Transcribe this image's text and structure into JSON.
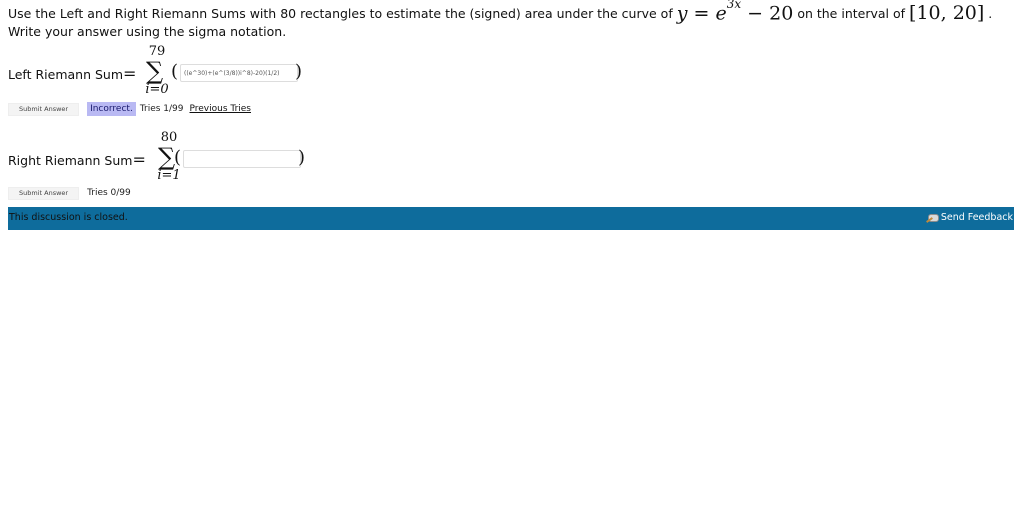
{
  "problem": {
    "intro": "Use the Left and Right Riemann Sums with 80 rectangles to estimate the (signed) area under the curve of",
    "func_y": "y",
    "func_eq": "=",
    "func_base": "e",
    "func_exp": "3x",
    "func_rest": "− 20",
    "interval_text": "on the interval of",
    "interval": "[10, 20]",
    "period": ".",
    "instruction": "Write your answer using the sigma notation."
  },
  "left_sum": {
    "label": "Left Riemann Sum",
    "equals": "=",
    "upper": "79",
    "lower": "i=0",
    "sigma": "∑",
    "open_paren": "(",
    "close_paren": ")",
    "input_value": "((e^30)+(e^(3/8))i^8)-20)(1/2)",
    "submit_label": "Submit Answer",
    "status": "Incorrect.",
    "tries": "Tries 1/99",
    "previous_tries": "Previous Tries"
  },
  "right_sum": {
    "label": "Right Riemann Sum",
    "equals": "=",
    "upper": "80",
    "lower": "i=1",
    "sigma": "∑",
    "open_paren": "(",
    "close_paren": ")",
    "input_value": "",
    "submit_label": "Submit Answer",
    "tries": "Tries 0/99"
  },
  "discussion": {
    "closed_text": "This discussion is closed.",
    "feedback_label": "Send Feedback",
    "feedback_icon": "feedback-pencil-icon",
    "bar_color": "#0e6c9c"
  },
  "colors": {
    "incorrect_badge": "#b9b9f3"
  }
}
